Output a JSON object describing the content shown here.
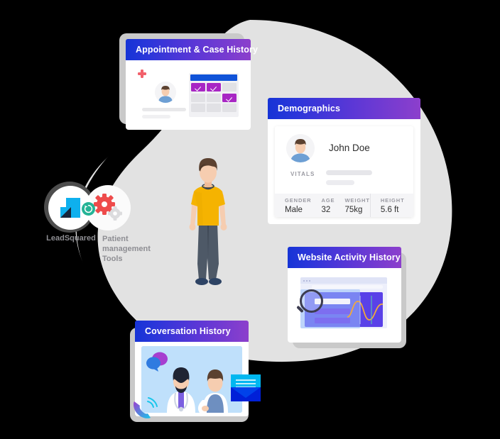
{
  "theme": {
    "background": "#000000",
    "blob_color": "#e2e2e2",
    "header_gradient_start": "#1634d6",
    "header_gradient_end": "#8c3fcc",
    "accent_purple": "#a826c4",
    "accent_blue": "#1053d8",
    "logo_cyan": "#0eb0ee",
    "gear_red": "#ee4b4b",
    "sync_teal": "#24b396",
    "shirt_yellow": "#f5b301",
    "jeans_gray": "#4e5967"
  },
  "cards": {
    "appointment": {
      "title": "Appointment & Case History",
      "grid": [
        [
          "on",
          "on",
          "off"
        ],
        [
          "off",
          "off",
          "on"
        ],
        [
          "off",
          "off",
          "off"
        ]
      ],
      "icon": "medical-cross-icon"
    },
    "demographics": {
      "title": "Demographics",
      "patient_name": "John Doe",
      "vitals_label": "VITALS",
      "stats": [
        {
          "label": "GENDER",
          "value": "Male"
        },
        {
          "label": "AGE",
          "value": "32"
        },
        {
          "label": "WEIGHT",
          "value": "75kg"
        },
        {
          "label": "HEIGHT",
          "value": "5.6 ft"
        }
      ]
    },
    "website_activity": {
      "title": "Website Activity History",
      "icon": "magnifier-icon"
    },
    "conversation": {
      "title": "Coversation History",
      "icons": [
        "chat-bubbles-icon",
        "phone-ring-icon",
        "envelope-icon"
      ]
    }
  },
  "integration": {
    "leadsquared_label": "LeadSquared",
    "tools_label": "Patient management Tools",
    "sync_icon": "sync-icon",
    "tools_icon": "gears-icon"
  }
}
